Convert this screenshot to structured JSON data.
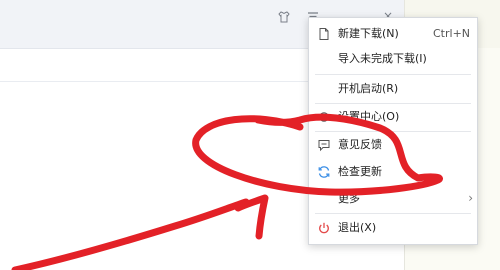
{
  "menu": {
    "items": [
      {
        "label": "新建下载(N)",
        "shortcut": "Ctrl+N",
        "icon": "new-file-icon"
      },
      {
        "label": "导入未完成下载(I)"
      },
      {
        "label": "开机启动(R)"
      },
      {
        "label": "设置中心(O)",
        "icon": "gear-icon"
      },
      {
        "label": "意见反馈",
        "icon": "feedback-icon"
      },
      {
        "label": "检查更新",
        "icon": "refresh-icon"
      },
      {
        "label": "更多",
        "submenu_arrow": "›"
      },
      {
        "label": "退出(X)",
        "icon": "power-icon"
      }
    ]
  },
  "titlebar": {
    "close_glyph": "×"
  },
  "colors": {
    "annotation_red": "#e32127",
    "power_icon_red": "#e34a4a",
    "refresh_icon_blue": "#3a8ee6"
  }
}
